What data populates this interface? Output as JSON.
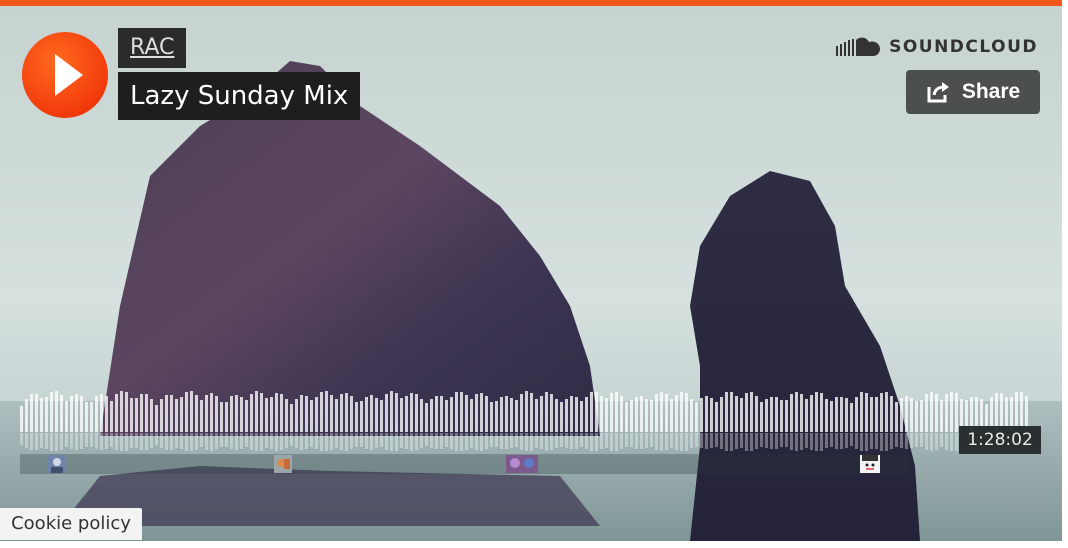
{
  "player": {
    "artist": "RAC",
    "track_title": "Lazy Sunday Mix",
    "brand": "SOUNDCLOUD",
    "share_label": "Share",
    "duration": "1:28:02",
    "accent_color": "#f2581b"
  },
  "footer": {
    "cookie_label": "Cookie policy"
  },
  "icons": {
    "play": "play-icon",
    "brand": "soundcloud-logo-icon",
    "share": "share-icon"
  }
}
